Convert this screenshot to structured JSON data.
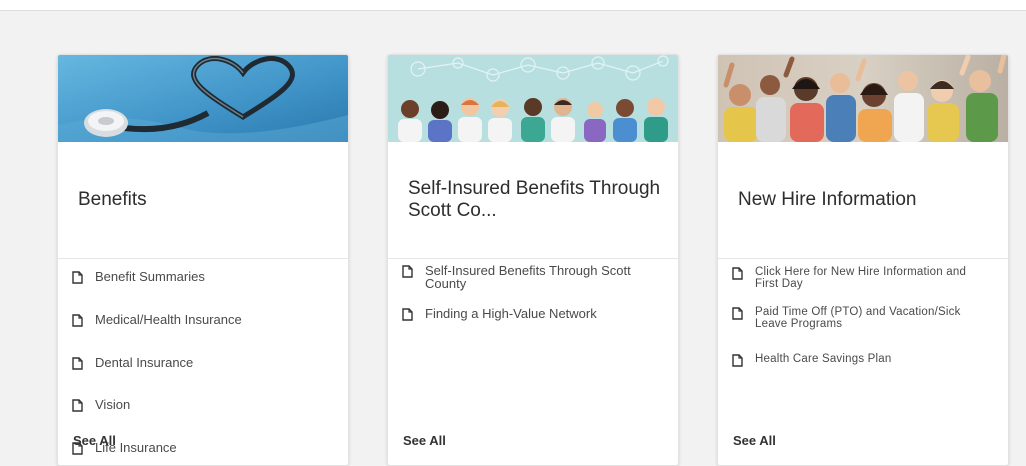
{
  "cards": [
    {
      "title": "Benefits",
      "image_icon": "stethoscope-heart-image",
      "links": [
        "Benefit Summaries",
        "Medical/Health Insurance",
        "Dental Insurance",
        "Vision",
        "Life Insurance"
      ],
      "see_all": "See All"
    },
    {
      "title": "Self-Insured Benefits Through Scott Co...",
      "image_icon": "medical-staff-illustration",
      "links": [
        "Self-Insured Benefits Through Scott County",
        "Finding a High-Value Network"
      ],
      "see_all": "See All"
    },
    {
      "title": "New Hire Information",
      "image_icon": "cheering-people-photo",
      "links": [
        "Click Here for New Hire Information and First Day",
        "Paid Time Off (PTO) and Vacation/Sick Leave Programs",
        "Health Care Savings Plan"
      ],
      "see_all": "See All"
    }
  ],
  "colors": {
    "background": "#f2f2f2",
    "card": "#ffffff",
    "image_blue": "#4a9fd0",
    "image_teal": "#a8d8d8"
  }
}
